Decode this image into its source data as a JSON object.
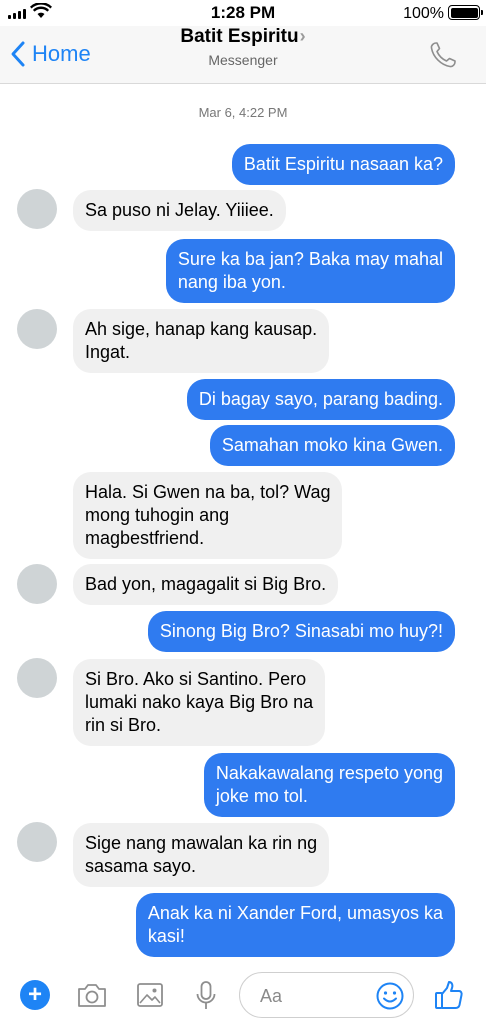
{
  "status_bar": {
    "time": "1:28 PM",
    "battery": "100%"
  },
  "nav": {
    "back_label": "Home",
    "title": "Batit Espiritu",
    "subtitle": "Messenger"
  },
  "timestamp": "Mar 6, 4:22 PM",
  "messages": [
    {
      "from": "me",
      "lines": [
        "Batit Espiritu nasaan ka?"
      ]
    },
    {
      "from": "them",
      "lines": [
        "Sa puso ni Jelay. Yiiiee."
      ]
    },
    {
      "from": "me",
      "lines": [
        "Sure ka ba jan? Baka may mahal",
        "nang iba yon."
      ]
    },
    {
      "from": "them",
      "lines": [
        "Ah sige, hanap kang kausap.",
        "Ingat."
      ]
    },
    {
      "from": "me",
      "lines": [
        "Di bagay sayo, parang bading."
      ]
    },
    {
      "from": "me",
      "lines": [
        "Samahan moko kina Gwen."
      ]
    },
    {
      "from": "them",
      "lines": [
        "Hala. Si Gwen na ba, tol? Wag",
        "mong tuhogin ang",
        "magbestfriend."
      ]
    },
    {
      "from": "them",
      "lines": [
        "Bad yon, magagalit si Big Bro."
      ]
    },
    {
      "from": "me",
      "lines": [
        "Sinong Big Bro? Sinasabi mo huy?!"
      ]
    },
    {
      "from": "them",
      "lines": [
        "Si Bro. Ako si Santino. Pero",
        "lumaki nako kaya Big Bro na",
        "rin si Bro."
      ]
    },
    {
      "from": "me",
      "lines": [
        "Nakakawalang respeto yong",
        "joke mo tol."
      ]
    },
    {
      "from": "them",
      "lines": [
        "Sige nang mawalan ka rin ng",
        "sasama sayo."
      ]
    },
    {
      "from": "me",
      "lines": [
        "Anak ka ni Xander Ford, umasyos ka",
        "kasi!"
      ]
    }
  ],
  "composer": {
    "placeholder": "Aa"
  },
  "colors": {
    "accent": "#1e84f5",
    "outgoing_bubble": "#2f7bf0",
    "incoming_bubble": "#f0f0f0"
  },
  "icons": [
    "signal-icon",
    "wifi-icon",
    "battery-icon",
    "back-chevron-icon",
    "phone-icon",
    "plus-icon",
    "camera-icon",
    "image-icon",
    "microphone-icon",
    "smiley-icon",
    "thumbs-up-icon"
  ]
}
